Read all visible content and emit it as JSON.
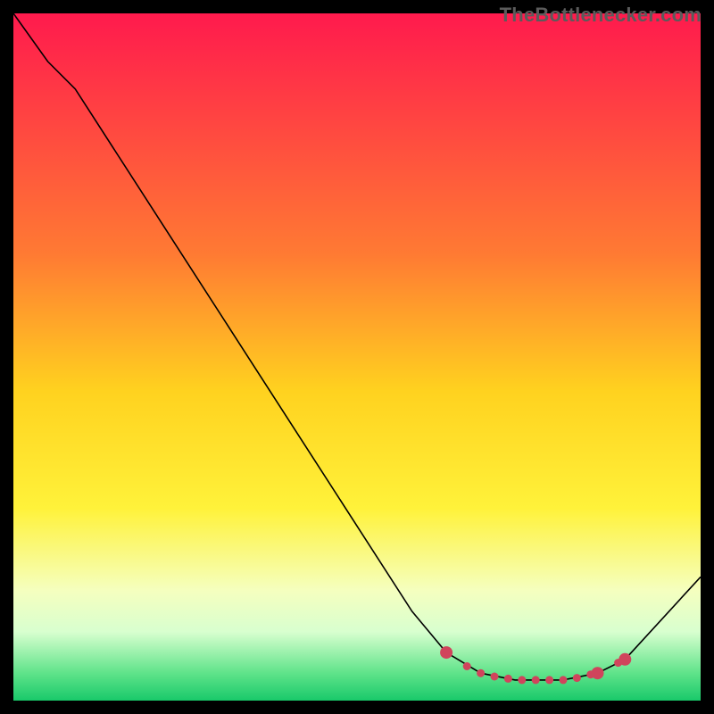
{
  "watermark": "TheBottlenecker.com",
  "chart_data": {
    "type": "line",
    "title": "",
    "xlabel": "",
    "ylabel": "",
    "xlim": [
      0,
      100
    ],
    "ylim": [
      0,
      100
    ],
    "gradient_stops": [
      {
        "offset": 0.0,
        "color": "#ff1a4d"
      },
      {
        "offset": 0.35,
        "color": "#ff7a33"
      },
      {
        "offset": 0.55,
        "color": "#ffd21f"
      },
      {
        "offset": 0.72,
        "color": "#fff23a"
      },
      {
        "offset": 0.84,
        "color": "#f5ffbf"
      },
      {
        "offset": 0.9,
        "color": "#d8ffcf"
      },
      {
        "offset": 0.96,
        "color": "#5fe38a"
      },
      {
        "offset": 1.0,
        "color": "#19c96a"
      }
    ],
    "series": [
      {
        "name": "bottleneck-curve",
        "color": "#000000",
        "width": 1.6,
        "points": [
          {
            "x": 0,
            "y": 100
          },
          {
            "x": 5,
            "y": 93
          },
          {
            "x": 9,
            "y": 89
          },
          {
            "x": 58,
            "y": 13
          },
          {
            "x": 63,
            "y": 7
          },
          {
            "x": 68,
            "y": 4
          },
          {
            "x": 73,
            "y": 3
          },
          {
            "x": 80,
            "y": 3
          },
          {
            "x": 85,
            "y": 4
          },
          {
            "x": 89,
            "y": 6
          },
          {
            "x": 100,
            "y": 18
          }
        ]
      }
    ],
    "markers": {
      "name": "sweet-spot",
      "color": "#d0445c",
      "radius_large": 7,
      "radius_small": 4.5,
      "points": [
        {
          "x": 63,
          "y": 7,
          "size": "large"
        },
        {
          "x": 66,
          "y": 5,
          "size": "small"
        },
        {
          "x": 68,
          "y": 4,
          "size": "small"
        },
        {
          "x": 70,
          "y": 3.5,
          "size": "small"
        },
        {
          "x": 72,
          "y": 3.2,
          "size": "small"
        },
        {
          "x": 74,
          "y": 3,
          "size": "small"
        },
        {
          "x": 76,
          "y": 3,
          "size": "small"
        },
        {
          "x": 78,
          "y": 3,
          "size": "small"
        },
        {
          "x": 80,
          "y": 3,
          "size": "small"
        },
        {
          "x": 82,
          "y": 3.3,
          "size": "small"
        },
        {
          "x": 84,
          "y": 3.8,
          "size": "small"
        },
        {
          "x": 85,
          "y": 4,
          "size": "large"
        },
        {
          "x": 88,
          "y": 5.5,
          "size": "small"
        },
        {
          "x": 89,
          "y": 6,
          "size": "large"
        }
      ]
    }
  }
}
